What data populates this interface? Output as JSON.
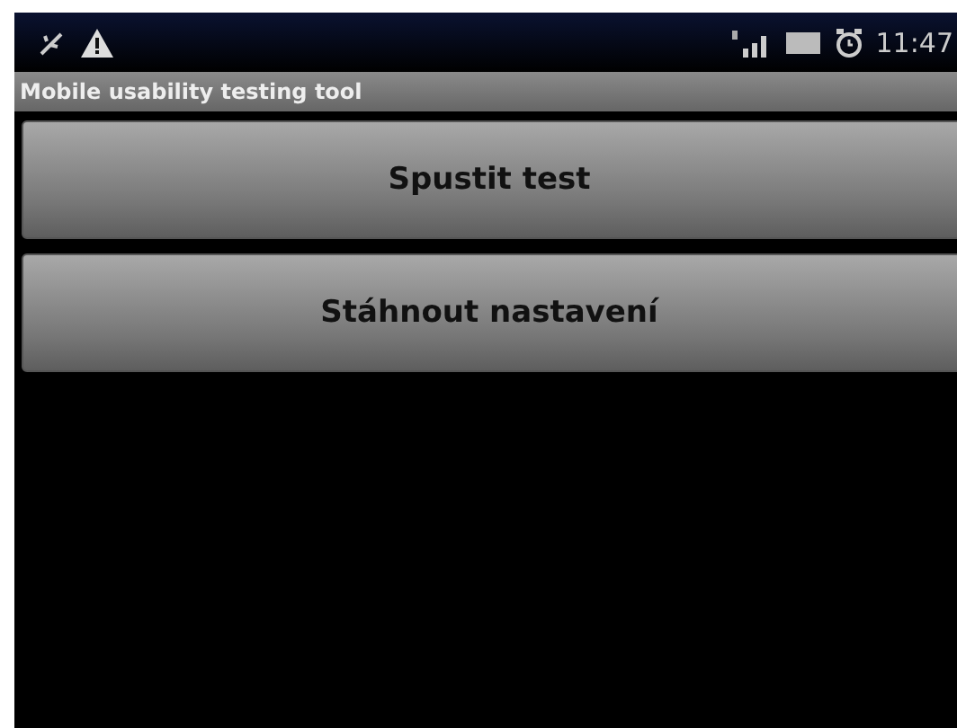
{
  "status_bar": {
    "time": "11:47"
  },
  "title_bar": {
    "title": "Mobile usability testing tool"
  },
  "buttons": [
    "Spustit test",
    "Stáhnout nastavení"
  ]
}
